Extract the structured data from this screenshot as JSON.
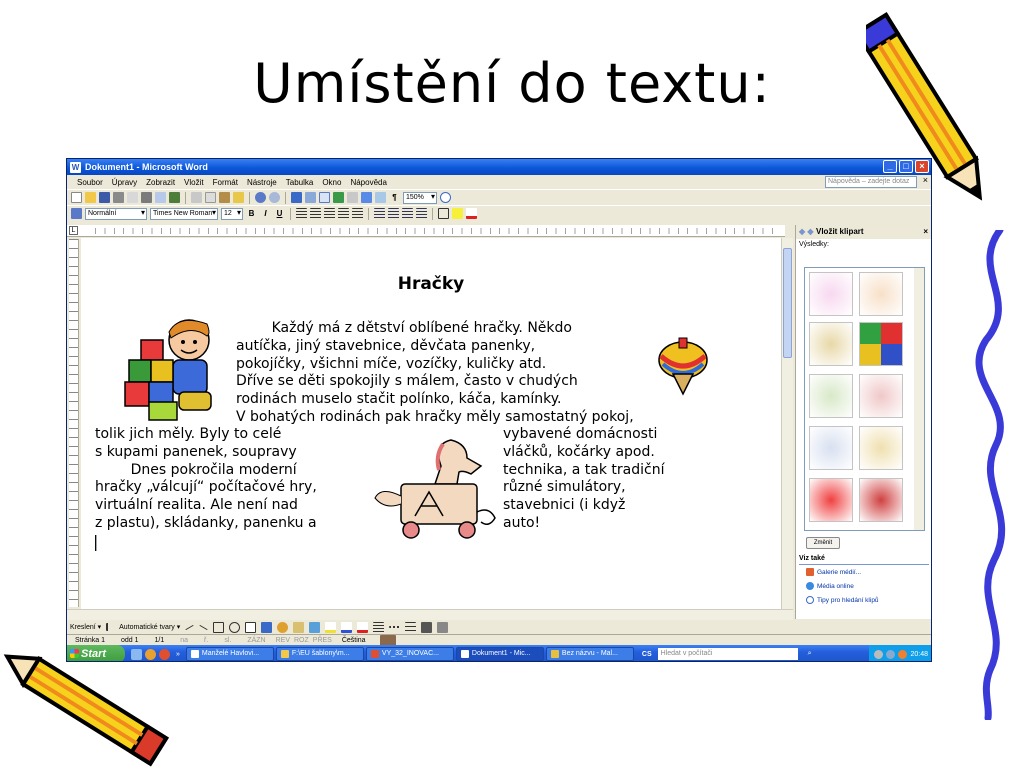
{
  "slide": {
    "title": "Umístění do textu:"
  },
  "window": {
    "title": "Dokument1 - Microsoft Word",
    "app_icon_letter": "W",
    "controls": {
      "minimize": "_",
      "maximize": "□",
      "close": "×"
    }
  },
  "menu": {
    "items": [
      "Soubor",
      "Úpravy",
      "Zobrazit",
      "Vložit",
      "Formát",
      "Nástroje",
      "Tabulka",
      "Okno",
      "Nápověda"
    ],
    "help_placeholder": "Nápověda – zadejte dotaz",
    "close": "×"
  },
  "toolbar": {
    "zoom": "150%",
    "paragraph_mark": "¶",
    "style": "Normální",
    "font": "Times New Roman",
    "size": "12",
    "bold": "B",
    "italic": "I",
    "underline": "U"
  },
  "document": {
    "heading": "Hračky",
    "paragraph_1": "        Každý má z dětství oblíbené hračky. Někdo\nautíčka, jiný stavebnice, děvčata panenky,\npokojíčky, všichni míče, vozíčky, kuličky atd.\nDříve se děti spokojily s málem, často v chudých\nrodinách muselo stačit polínko, káča, kamínky.\nV bohatých rodinách pak hračky měly samostatný pokoj,",
    "left_column": "tolik jich měly. Byly to celé\ns kupami panenek, soupravy\n        Dnes pokročila moderní\nhračky „válcují“ počítačové hry,\nvirtuální realita. Ale není nad\nz plastu), skládanky, panenku a",
    "right_column": "vybavené domácnosti\nvláčků, kočárky apod.\ntechnika, a tak tradiční\nrůzné simulátory,\nstavebnici (i když\nauto!",
    "cursor": "|"
  },
  "task_pane": {
    "title": "Vložit klipart",
    "results_label": "Výsledky:",
    "change_button": "Změnit",
    "see_also": "Viz také",
    "links": [
      "Galerie médií...",
      "Média online",
      "Tipy pro hledání klipů"
    ],
    "close": "×"
  },
  "drawing_toolbar": {
    "draw": "Kreslení ▾",
    "autoshapes": "Automatické tvary ▾"
  },
  "status": {
    "page": "Stránka  1",
    "section": "odd  1",
    "pages": "1/1",
    "at": "na",
    "line": "ř.",
    "col": "sl.",
    "rec": "ZÁZN",
    "rev": "REV",
    "ext": "ROZ",
    "ovr": "PŘES",
    "language": "Čeština"
  },
  "taskbar": {
    "start": "Start",
    "more": "»",
    "tasks": [
      "Manželé Havlovi...",
      "F:\\EU šablony\\m...",
      "VY_32_INOVAC...",
      "Dokument1 - Mic...",
      "Bez názvu - Mal..."
    ],
    "active_task": 3,
    "lang": "CS",
    "search_placeholder": "Hledat v počítači",
    "clock": "20:48"
  },
  "colors": {
    "titlebar": "#0a55d8",
    "window_bg": "#ece9d8",
    "taskbar": "#245edb",
    "pencil_yellow": "#f7d21c",
    "pencil_orange": "#f08a1c",
    "squiggle": "#3a3ad8"
  }
}
